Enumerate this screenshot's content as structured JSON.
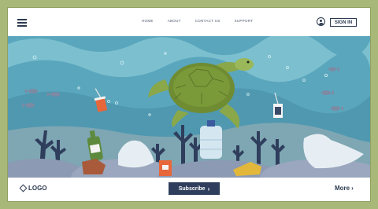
{
  "header": {
    "nav": [
      "HOME",
      "ABOUT",
      "CONTACT US",
      "SUPPORT"
    ],
    "signin_label": "SIGN IN"
  },
  "footer": {
    "logo_label": "LOGO",
    "subscribe_label": "Subscribe",
    "more_label": "More"
  },
  "colors": {
    "background": "#a8b878",
    "sea": "#6fb6c6",
    "navy": "#2f3e5c",
    "turtle": "#7a9a3a"
  },
  "icons": [
    "menu-icon",
    "user-icon",
    "logo-diamond-icon",
    "chevron-right-icon"
  ]
}
